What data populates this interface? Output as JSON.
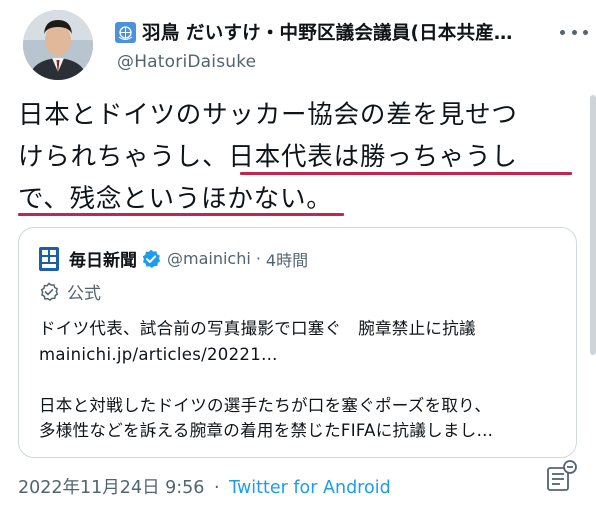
{
  "author": {
    "display_name": "羽鳥 だいすけ・中野区議会議員(日本共産…",
    "handle": "@HatoriDaisuke",
    "badge_icon": "united-nations-emblem-icon"
  },
  "tweet": {
    "lines": [
      "日本とドイツのサッカー協会の差を見せつ",
      "けられちゃうし、日本代表は勝っちゃうし",
      "で、残念というほかない。"
    ],
    "underline_color": "#c4254f"
  },
  "quote": {
    "account_name": "毎日新聞",
    "handle": "@mainichi",
    "separator": "·",
    "time": "4時間",
    "official_label": "公式",
    "headline": "ドイツ代表、試合前の写真撮影で口塞ぐ　腕章禁止に抗議",
    "link": "mainichi.jp/articles/20221…",
    "summary_line1": "日本と対戦したドイツの選手たちが口を塞ぐポーズを取り、",
    "summary_line2": "多様性などを訴える腕章の着用を禁じたFIFAに抗議しまし…"
  },
  "footer": {
    "timestamp": "2022年11月24日 9:56",
    "separator": "·",
    "source": "Twitter for Android"
  },
  "colors": {
    "text": "#0f1419",
    "secondary": "#536471",
    "link": "#1d9bf0",
    "verified": "#1d9bf0",
    "border": "#cfd9de"
  }
}
